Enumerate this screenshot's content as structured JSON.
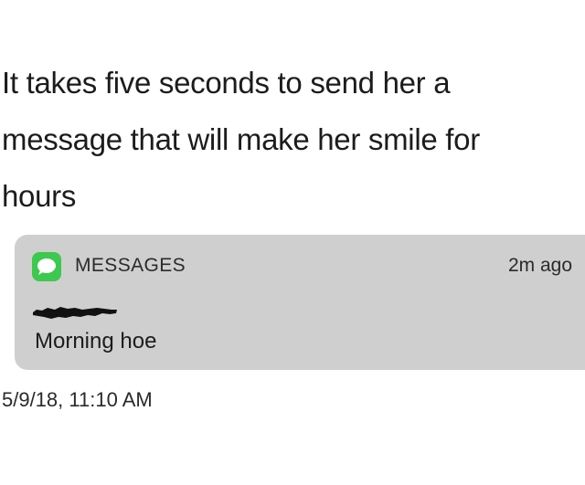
{
  "caption": {
    "line1": "It takes five seconds to send her a",
    "line2": "message that will make her smile for",
    "line3": "hours"
  },
  "notification": {
    "app_name": "MESSAGES",
    "icon": "messages-bubble-icon",
    "icon_color": "#3cc94e",
    "time_ago": "2m ago",
    "sender_redacted": true,
    "message": "Morning hoe",
    "background_color": "#cfcfcf"
  },
  "timestamp": "5/9/18, 11:10 AM"
}
